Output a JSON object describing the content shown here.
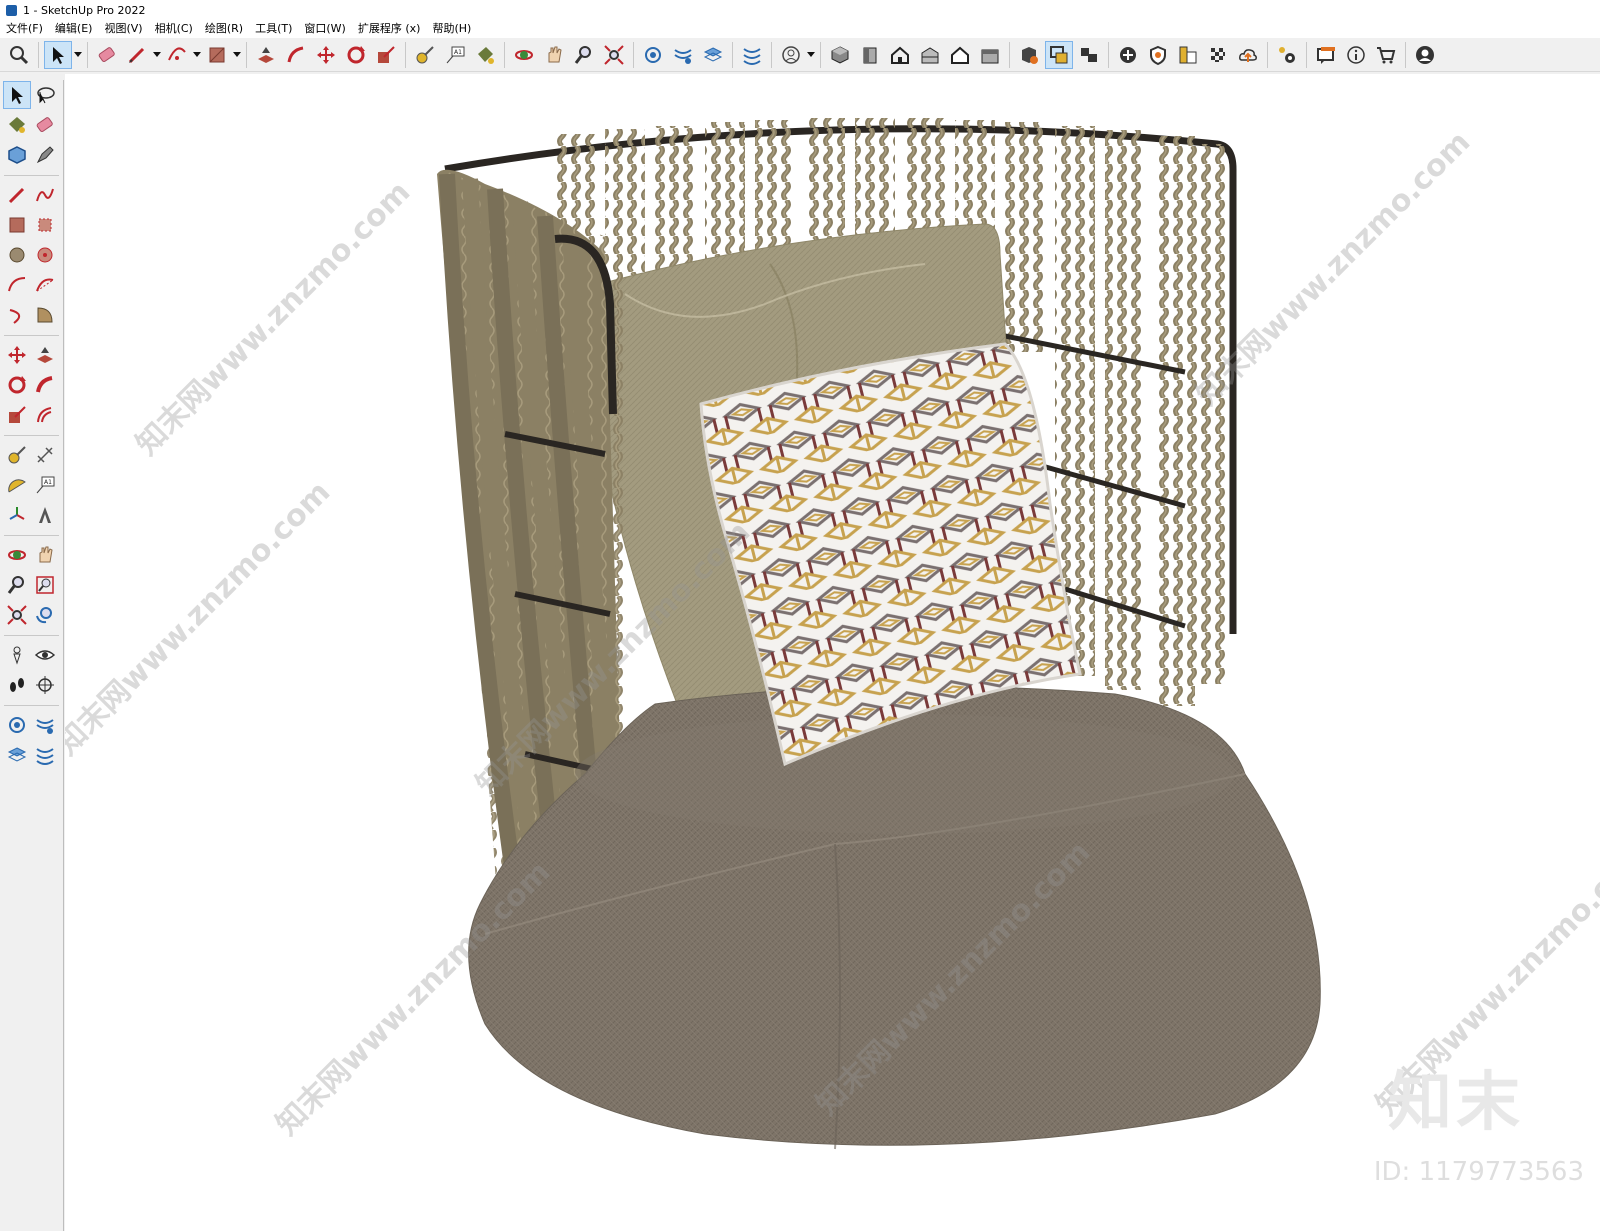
{
  "window": {
    "title": "1 - SketchUp Pro 2022"
  },
  "menu": {
    "items": [
      "文件(F)",
      "编辑(E)",
      "视图(V)",
      "相机(C)",
      "绘图(R)",
      "工具(T)",
      "窗口(W)",
      "扩展程序 (x)",
      "帮助(H)"
    ]
  },
  "toolbar": {
    "icons": [
      "zoom-icon",
      "select-icon",
      "eraser-icon",
      "pencil-icon",
      "arc-icon",
      "rectangle-icon",
      "push-pull-icon",
      "follow-me-icon",
      "move-icon",
      "rotate-icon",
      "scale-icon",
      "tape-measure-icon",
      "text-icon",
      "paint-bucket-icon",
      "orbit-icon",
      "pan-icon",
      "zoom-tool-icon",
      "zoom-extents-icon",
      "tag-icon",
      "section-icon",
      "layers-icon",
      "style-icon",
      "account-icon",
      "iso-view-icon",
      "front-view-icon",
      "top-view-icon",
      "right-view-icon",
      "back-view-icon",
      "left-view-icon",
      "warehouse-icon",
      "component-icon",
      "scene-icon",
      "add-icon",
      "shield-icon",
      "materials-icon",
      "checker-icon",
      "cloud-upload-icon",
      "settings-icon",
      "message-icon",
      "info-icon",
      "cart-icon",
      "profile-icon"
    ]
  },
  "viewport": {
    "watermark_text": "知末网www.znzmo.com",
    "brand_logo": "知末",
    "image_id": "ID: 1179773563"
  },
  "colors": {
    "rope": "#8b8064",
    "rope_dark": "#6b624a",
    "frame": "#2a2622",
    "cushion_back": "#a39b7f",
    "seat": "#7e7468",
    "pillow_base": "#f4f2ef",
    "pillow_gold": "#c7a24f",
    "pillow_maroon": "#7a3a3a"
  }
}
